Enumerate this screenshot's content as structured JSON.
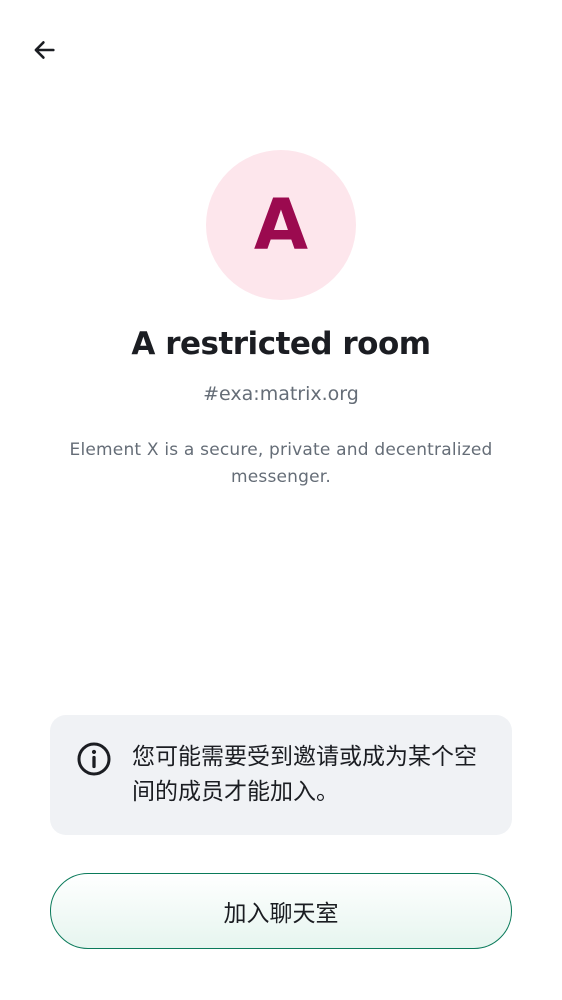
{
  "header": {
    "back_icon": "arrow-left-icon"
  },
  "room": {
    "avatar_letter": "A",
    "name": "A restricted room",
    "alias": "#exa:matrix.org",
    "topic": "Element X is a secure, private and decentralized messenger."
  },
  "notice": {
    "icon": "info-icon",
    "text": "您可能需要受到邀请或成为某个空间的成员才能加入。"
  },
  "actions": {
    "join_label": "加入聊天室"
  },
  "colors": {
    "avatar_bg": "#fde6ec",
    "avatar_fg": "#9b0a4f",
    "notice_bg": "#f0f2f5",
    "join_border": "#0a7a5a",
    "join_bg_top": "#ffffff",
    "join_bg_bottom": "#e6f5ef"
  }
}
